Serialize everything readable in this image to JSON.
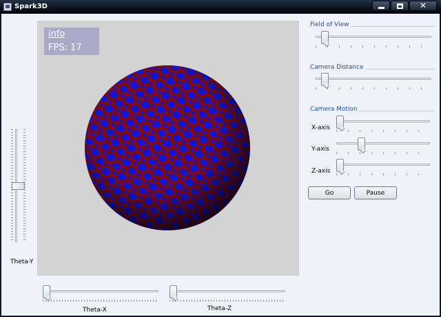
{
  "window": {
    "title": "Spark3D",
    "minimize_icon": "minimize-icon",
    "maximize_icon": "maximize-icon",
    "close_glyph": "✕"
  },
  "viewport": {
    "info_title": "info",
    "fps_text": "FPS: 17",
    "background": "#d3d3d3",
    "sphere_colors": {
      "primary": "#1515d8",
      "secondary": "#8a0a0a"
    }
  },
  "controls": {
    "fov": {
      "title": "Field of View",
      "value": 0.05
    },
    "distance": {
      "title": "Camera Distance",
      "value": 0.05
    },
    "motion": {
      "title": "Camera Motion",
      "x_axis": {
        "label": "X-axis",
        "value": 0.0
      },
      "y_axis": {
        "label": "Y-axis",
        "value": 0.25
      },
      "z_axis": {
        "label": "Z-axis",
        "value": 0.0
      }
    },
    "go_label": "Go",
    "pause_label": "Pause"
  },
  "theta": {
    "y": {
      "label": "Theta-Y",
      "value": 0.5
    },
    "x": {
      "label": "Theta-X",
      "value": 0.0
    },
    "z": {
      "label": "Theta-Z",
      "value": 0.0
    }
  }
}
